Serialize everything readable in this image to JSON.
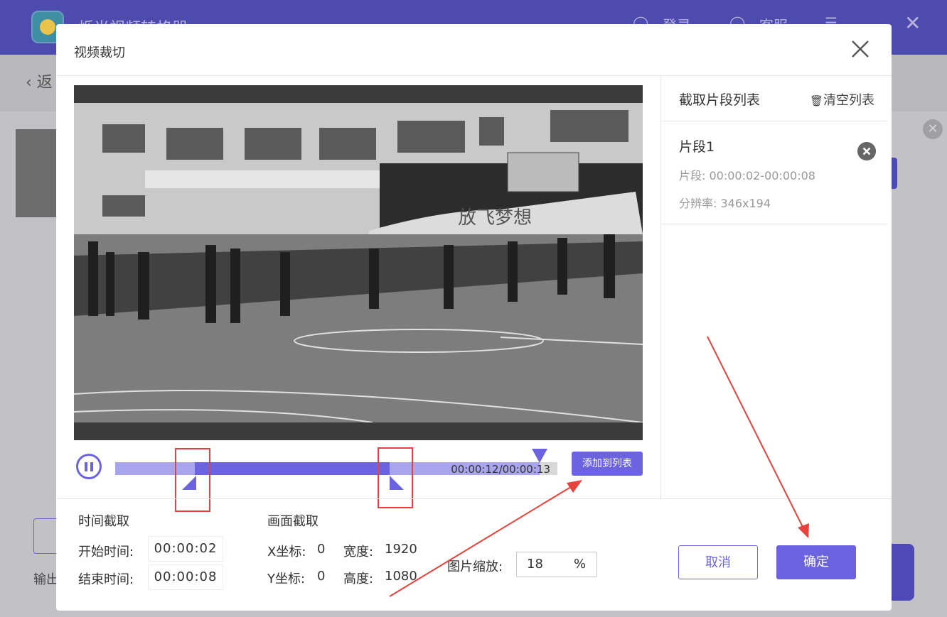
{
  "app": {
    "title": "烁光视频转格器",
    "login": "登录",
    "service": "客服",
    "back": "返",
    "output": "输出"
  },
  "dialog": {
    "title": "视频裁切"
  },
  "player": {
    "time_display": "00:00:12/00:00:13",
    "add_to_list": "添加到列表",
    "progress": 0.96,
    "clip_start_fraction": 0.18,
    "clip_end_fraction": 0.62
  },
  "time_crop": {
    "heading": "时间截取",
    "start_label": "开始时间:",
    "start_value": "00:00:02",
    "end_label": "结束时间:",
    "end_value": "00:00:08"
  },
  "frame_crop": {
    "heading": "画面截取",
    "x_label": "X坐标:",
    "x_value": "0",
    "y_label": "Y坐标:",
    "y_value": "0",
    "w_label": "宽度:",
    "w_value": "1920",
    "h_label": "高度:",
    "h_value": "1080"
  },
  "scale": {
    "label": "图片缩放:",
    "value": "18",
    "unit": "%"
  },
  "buttons": {
    "cancel": "取消",
    "ok": "确定"
  },
  "segment_list": {
    "title": "截取片段列表",
    "clear": "清空列表",
    "items": [
      {
        "name": "片段1",
        "range": "片段: 00:00:02-00:00:08",
        "resolution": "分辨率: 346x194"
      }
    ]
  },
  "colors": {
    "accent": "#6c63e0",
    "annotation": "#e8423c",
    "header": "#4e4bae"
  },
  "video_frame_text": "放飞梦想"
}
